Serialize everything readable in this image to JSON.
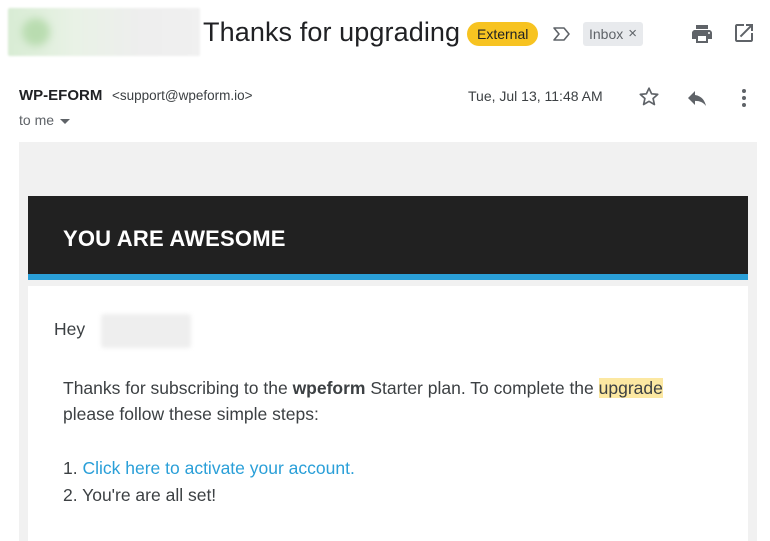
{
  "subject": {
    "title": "Thanks for upgrading",
    "external_label": "External",
    "inbox_label": "Inbox",
    "inbox_remove": "×"
  },
  "header": {
    "sender_name": "WP-EFORM",
    "sender_email": "<support@wpeform.io>",
    "recipient": "to me",
    "timestamp": "Tue, Jul 13, 11:48 AM"
  },
  "icons": {
    "importance": "importance-marker-icon",
    "print": "print-icon",
    "popout": "open-in-new-window-icon",
    "star": "star-icon",
    "reply": "reply-icon",
    "more": "more-vertical-icon"
  },
  "email": {
    "banner_title": "YOU ARE AWESOME",
    "greeting": "Hey",
    "line1_a": "Thanks for subscribing to the ",
    "line1_brand": "wpeform",
    "line1_b": " Starter plan. To complete the ",
    "line1_highlight": "upgrade",
    "line2": "please follow these simple steps:",
    "step1_prefix": "1. ",
    "step1_link": "Click here to activate your account.",
    "step2": "2. You're are all set!"
  },
  "colors": {
    "external_badge": "#f7c321",
    "banner_bg": "#212121",
    "banner_accent": "#2a9fd8",
    "link": "#2a9fd8",
    "highlight": "#fce8a2"
  }
}
